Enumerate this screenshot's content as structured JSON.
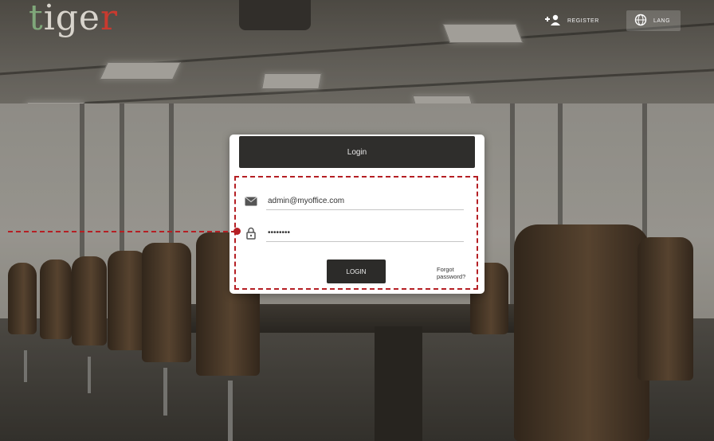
{
  "brand": {
    "logo_part1": "t",
    "logo_part2": "ige",
    "logo_part3": "r"
  },
  "header": {
    "register_label": "REGISTER",
    "language_label": "LANG"
  },
  "login_card": {
    "title": "Login",
    "email_value": "admin@myoffice.com",
    "email_icon": "envelope-icon",
    "password_value": "••••••••",
    "password_icon": "lock-icon",
    "login_button": "LOGIN",
    "forgot_password": "Forgot password?"
  },
  "colors": {
    "highlight": "#b51f24",
    "card_header": "#2f2e2c",
    "button": "#2c2b29"
  }
}
